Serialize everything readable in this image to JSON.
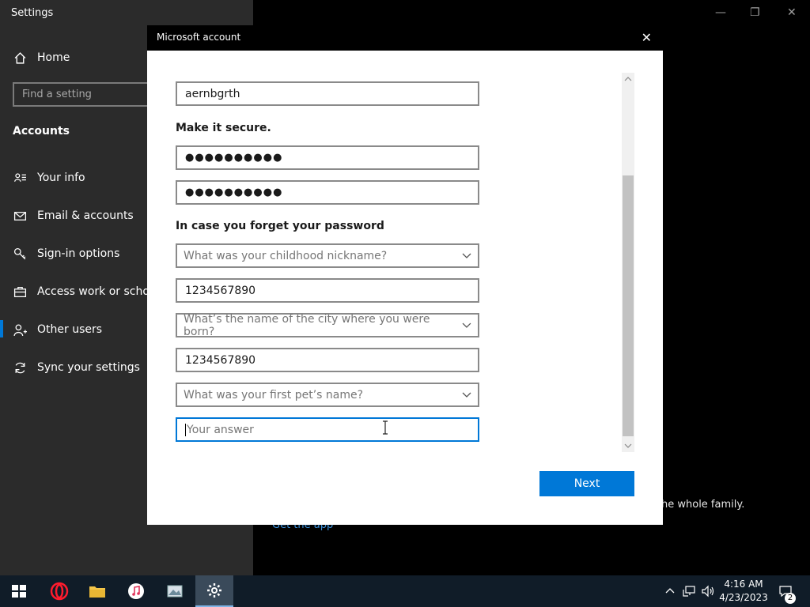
{
  "settings": {
    "title": "Settings",
    "home_label": "Home",
    "search_placeholder": "Find a setting",
    "section_heading": "Accounts",
    "nav": [
      {
        "label": "Your info",
        "icon": "person-card-icon"
      },
      {
        "label": "Email & accounts",
        "icon": "mail-icon"
      },
      {
        "label": "Sign-in options",
        "icon": "key-icon"
      },
      {
        "label": "Access work or school",
        "icon": "briefcase-icon"
      },
      {
        "label": "Other users",
        "icon": "person-add-icon"
      },
      {
        "label": "Sync your settings",
        "icon": "sync-icon"
      }
    ],
    "active_item": "Other users"
  },
  "background": {
    "family_text": "he whole family.",
    "get_app_link": "Get the app"
  },
  "dialog": {
    "title": "Microsoft account",
    "username_value": "aernbgrth",
    "secure_heading": "Make it secure.",
    "password_value": "●●●●●●●●●●",
    "confirm_password_value": "●●●●●●●●●●",
    "recovery_heading": "In case you forget your password",
    "question1": "What was your childhood nickname?",
    "answer1": "1234567890",
    "question2": "What’s the name of the city where you were born?",
    "answer2": "1234567890",
    "question3": "What was your first pet’s name?",
    "answer3_placeholder": "Your answer",
    "next_label": "Next"
  },
  "taskbar": {
    "time": "4:16 AM",
    "date": "4/23/2023",
    "notification_count": "2",
    "apps": [
      "start-icon",
      "opera-icon",
      "file-explorer-icon",
      "itunes-icon",
      "photos-icon",
      "settings-gear-icon"
    ]
  },
  "colors": {
    "accent": "#0078d7",
    "sidebar_bg": "#2b2b2b",
    "taskbar_bg": "#101c28"
  }
}
